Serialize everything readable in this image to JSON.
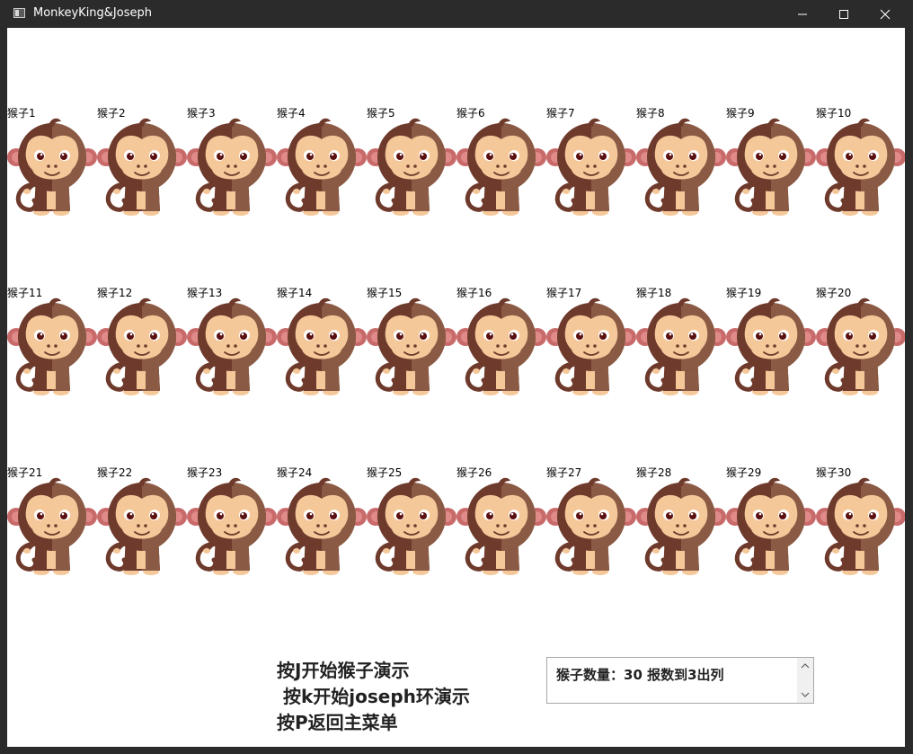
{
  "window": {
    "title": "MonkeyKing&Joseph",
    "controls": [
      "minimize-icon",
      "maximize-icon",
      "close-icon"
    ]
  },
  "monkeys": [
    "猴子1",
    "猴子2",
    "猴子3",
    "猴子4",
    "猴子5",
    "猴子6",
    "猴子7",
    "猴子8",
    "猴子9",
    "猴子10",
    "猴子11",
    "猴子12",
    "猴子13",
    "猴子14",
    "猴子15",
    "猴子16",
    "猴子17",
    "猴子18",
    "猴子19",
    "猴子20",
    "猴子21",
    "猴子22",
    "猴子23",
    "猴子24",
    "猴子25",
    "猴子26",
    "猴子27",
    "猴子28",
    "猴子29",
    "猴子30"
  ],
  "instructions": {
    "line1": "按J开始猴子演示",
    "line2": " 按k开始joseph环演示",
    "line3": "按P返回主菜单"
  },
  "info": {
    "text": "猴子数量：30  报数到3出列"
  },
  "colors": {
    "titlebar": "#2b2b2b",
    "monkey_dark": "#6e3a2c",
    "monkey_fur": "#8b5a44",
    "monkey_face": "#f5c89a",
    "monkey_ear": "#c96a6a"
  }
}
